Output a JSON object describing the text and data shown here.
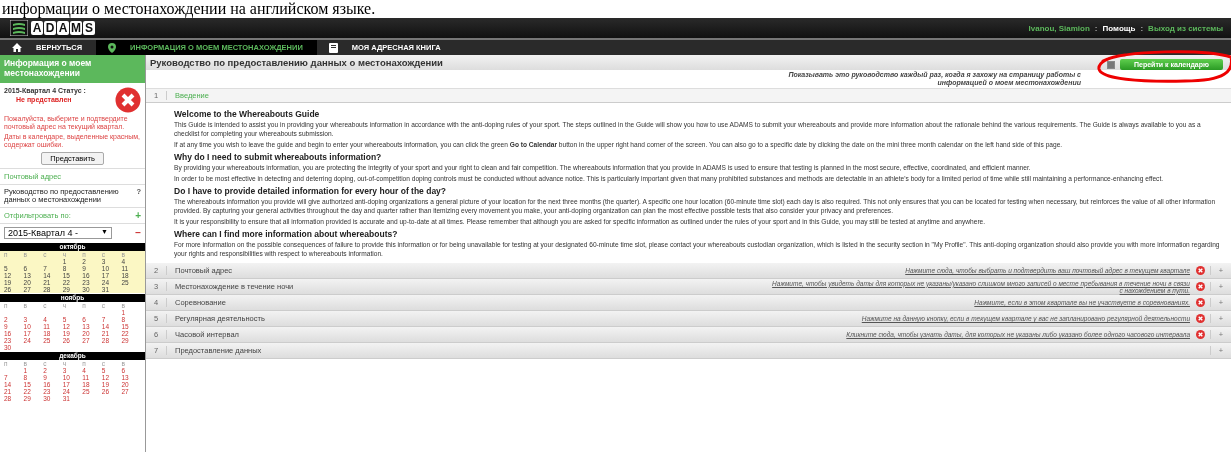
{
  "document_line": "информации о местонахождении на английском языке.",
  "header": {
    "logo_letters": [
      "A",
      "D",
      "A",
      "M",
      "S"
    ],
    "user": "Ivanou, Siamion",
    "separator": ":",
    "help": "Помощь",
    "logout": "Выход из системы"
  },
  "nav": [
    {
      "label": "ВЕРНУТЬСЯ",
      "selected": false
    },
    {
      "label": "ИНФОРМАЦИЯ О МОЕМ МЕСТОНАХОЖДЕНИИ",
      "selected": true
    },
    {
      "label": "МОЯ АДРЕСНАЯ КНИГА",
      "selected": false
    }
  ],
  "sidebar": {
    "title": "Информация о моем местонахождении",
    "status": {
      "label": "2015-Квартал 4 Статус :",
      "value": "Не представлен",
      "messages": [
        "Пожалуйста, выберите и подтвердите почтовый адрес на текущий квартал.",
        "Даты в календаре, выделенные красным, содержат ошибки."
      ],
      "button": "Представить"
    },
    "postal_address": "Почтовый адрес",
    "guide_link": "Руководство по предоставлению данных о местонахождении",
    "help_mark": "?",
    "filter": {
      "label": "Отфильтровать по:",
      "add": "+",
      "value": "2015-Квартал 4 -",
      "arrow": "▼",
      "remove": "−"
    },
    "months": [
      {
        "name": "октябрь",
        "highlighted": true,
        "weekdays": [
          "п",
          "в",
          "с",
          "ч",
          "п",
          "с",
          "в"
        ],
        "weeks": [
          [
            "1",
            "2",
            "3",
            "4"
          ],
          [
            "5",
            "6",
            "7",
            "8",
            "9",
            "10",
            "11"
          ],
          [
            "12",
            "13",
            "14",
            "15",
            "16",
            "17",
            "18"
          ],
          [
            "19",
            "20",
            "21",
            "22",
            "23",
            "24",
            "25"
          ],
          [
            "26",
            "27",
            "28",
            "29",
            "30",
            "31"
          ]
        ]
      },
      {
        "name": "ноябрь",
        "highlighted": false,
        "weekdays": [
          "п",
          "в",
          "с",
          "ч",
          "п",
          "с",
          "в"
        ],
        "weeks": [
          [
            "1"
          ],
          [
            "2",
            "3",
            "4",
            "5",
            "6",
            "7",
            "8"
          ],
          [
            "9",
            "10",
            "11",
            "12",
            "13",
            "14",
            "15"
          ],
          [
            "16",
            "17",
            "18",
            "19",
            "20",
            "21",
            "22"
          ],
          [
            "23",
            "24",
            "25",
            "26",
            "27",
            "28",
            "29"
          ],
          [
            "30"
          ]
        ]
      },
      {
        "name": "декабрь",
        "highlighted": false,
        "weekdays": [
          "п",
          "в",
          "с",
          "ч",
          "п",
          "с",
          "в"
        ],
        "weeks": [
          [
            "1",
            "2",
            "3",
            "4",
            "5",
            "6"
          ],
          [
            "7",
            "8",
            "9",
            "10",
            "11",
            "12",
            "13"
          ],
          [
            "14",
            "15",
            "16",
            "17",
            "18",
            "19",
            "20"
          ],
          [
            "21",
            "22",
            "23",
            "24",
            "25",
            "26",
            "27"
          ],
          [
            "28",
            "29",
            "30",
            "31"
          ]
        ]
      }
    ]
  },
  "main": {
    "title": "Руководство по предоставлению данных о местонахождении",
    "show_guide": {
      "checked": true,
      "text": "Показывать это руководство каждый раз, когда я захожу на страницу работы с",
      "text_2": "информацией о моем местонахождении"
    },
    "calendar_button": "Перейти к календарю",
    "sections": [
      {
        "number": "1",
        "title": "Введение",
        "expanded": true,
        "error": false,
        "content": [
          {
            "kind": "heading",
            "text": "Welcome to the Whereabouts Guide"
          },
          {
            "kind": "paragraph",
            "text": "This Guide is intended to assist you in providing your whereabouts information in accordance with the anti-doping rules of your sport. The steps outlined in the Guide will show you how to use ADAMS to submit your whereabouts and provide more information about the rationale behind the various requirements. The Guide is always available to you as a checklist for completing your whereabouts submission."
          },
          {
            "kind": "paragraph",
            "text": "If at any time you wish to leave the guide and begin to enter your whereabouts information, you can click the green **Go to Calendar** button in the upper right hand corner of the screen. You can also go to a specific date by clicking the date on the mini three month calendar on the left hand side of this page."
          },
          {
            "kind": "heading",
            "text": "Why do I need to submit whereabouts information?"
          },
          {
            "kind": "paragraph",
            "text": "By providing your whereabouts information, you are protecting the integrity of your sport and your right to clean and fair competition. The whereabouts information that you provide in ADAMS is used to ensure that testing is planned in the most secure, effective, coordinated, and efficient manner."
          },
          {
            "kind": "paragraph",
            "text": "In order to be most effective in detecting and deterring doping, out-of-competition doping controls must be conducted without advance notice. This is particularly important given that many prohibited substances and methods are detectable in an athlete's body for a limited period of time while still maintaining a performance-enhancing effect."
          },
          {
            "kind": "heading",
            "text": "Do I have to provide detailed information for every hour of the day?"
          },
          {
            "kind": "paragraph",
            "text": "The whereabouts information you provide will give authorized anti-doping organizations a general picture of your location for the next three months (the quarter). A specific one hour location (60-minute time slot) each day is also required. This not only ensures that you can be located for testing when necessary, but reinforces the value of all other information provided. By capturing your general activities throughout the day and quarter rather than itemizing every movement you make, your anti-doping organization can plan the most effective possible tests that also consider your privacy and preferences."
          },
          {
            "kind": "paragraph",
            "text": "It is your responsibility to ensure that all information provided is accurate and up-to-date at all times. Please remember that although you are asked for specific information as outlined under the rules of your sport and in this Guide, you may still be tested at anytime and anywhere."
          },
          {
            "kind": "heading",
            "text": "Where can I find more information about whereabouts?"
          },
          {
            "kind": "paragraph",
            "text": "For more information on the possible consequences of failure to provide this information or for being unavailable for testing at your designated 60-minute time slot, please contact your whereabouts custodian organization, which is listed in the security section in \"My Profile\". This anti-doping organization should also provide you with more information regarding your rights and responsibilities with respect to whereabouts information."
          }
        ]
      },
      {
        "number": "2",
        "title": "Почтовый адрес",
        "expanded": false,
        "error": true,
        "expand": "+",
        "link": "Нажмите сюда, чтобы выбрать и подтвердить ваш почтовый адрес в текущем квартале"
      },
      {
        "number": "3",
        "title": "Местонахождение в течение ночи",
        "expanded": false,
        "error": true,
        "expand": "+",
        "link": "Нажмите, чтобы увидеть даты для которых не указаны/указано слишком много записей о месте пребывания в течение ночи в связи с нахождением в пути."
      },
      {
        "number": "4",
        "title": "Соревнование",
        "expanded": false,
        "error": true,
        "expand": "+",
        "link": "Нажмите, если в этом квартале вы не участвуете в соревнованиях."
      },
      {
        "number": "5",
        "title": "Регулярная деятельность",
        "expanded": false,
        "error": true,
        "expand": "+",
        "link": "Нажмите на данную кнопку, если в текущем квартале у вас не запланировано регулярной деятельности"
      },
      {
        "number": "6",
        "title": "Часовой интервал",
        "expanded": false,
        "error": true,
        "expand": "+",
        "link": "Кликните сюда, чтобы узнать даты, для которых не указаны либо указано более одного часового интервала"
      },
      {
        "number": "7",
        "title": "Предоставление данных",
        "expanded": false,
        "error": false,
        "expand": "+"
      }
    ]
  }
}
